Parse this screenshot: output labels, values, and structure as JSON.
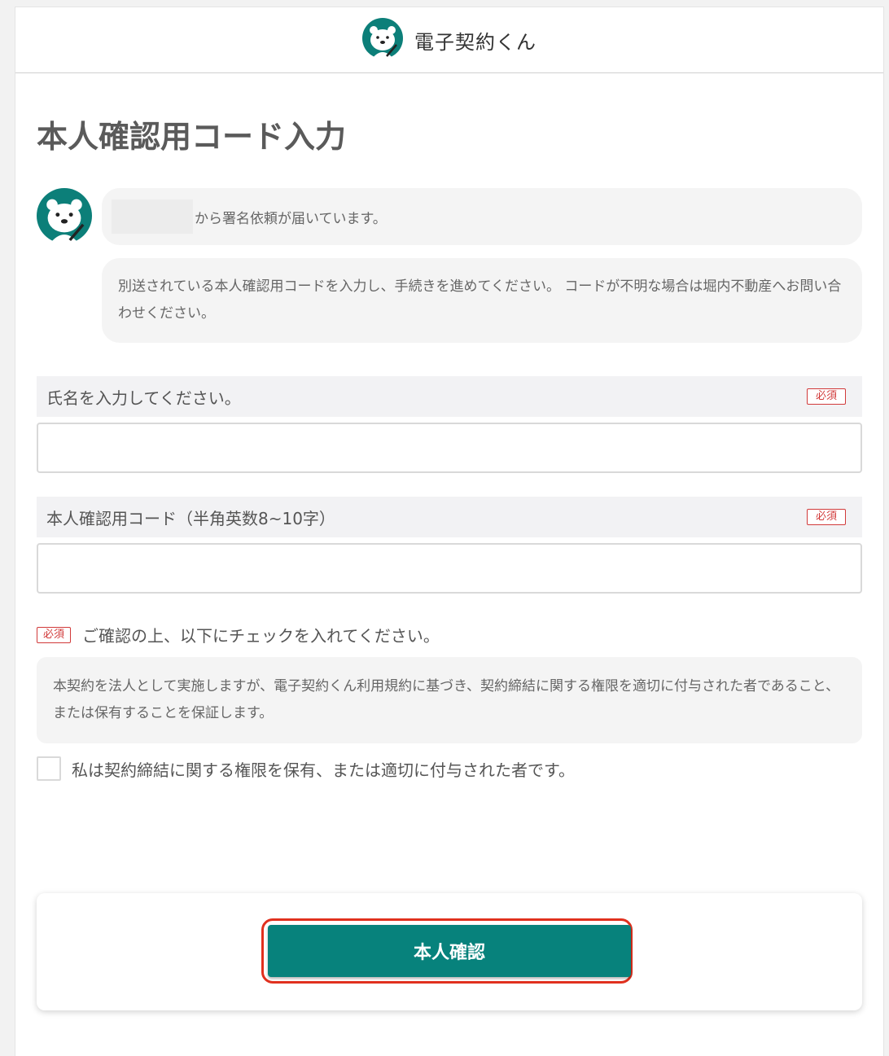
{
  "header": {
    "app_name": "電子契約くん",
    "logo_icon": "polar-bear-mascot-icon"
  },
  "page_title": "本人確認用コード入力",
  "messages": {
    "avatar_icon": "polar-bear-mascot-icon",
    "sender_suffix": "から署名依頼が届いています。",
    "instruction": "別送されている本人確認用コードを入力し、手続きを進めてください。 コードが不明な場合は堀内不動産へお問い合わせください。"
  },
  "name_field": {
    "label": "氏名を入力してください。",
    "required_badge": "必須",
    "value": "",
    "placeholder": ""
  },
  "code_field": {
    "label": "本人確認用コード（半角英数8~10字）",
    "required_badge": "必須",
    "value": "",
    "placeholder": ""
  },
  "confirm": {
    "required_badge": "必須",
    "label": "ご確認の上、以下にチェックを入れてください。",
    "terms_text": "本契約を法人として実施しますが、電子契約くん利用規約に基づき、契約締結に関する権限を適切に付与された者であること、または保有することを保証します。",
    "checkbox_label": "私は契約締結に関する権限を保有、または適切に付与された者です。",
    "checked": false
  },
  "submit": {
    "label": "本人確認"
  },
  "colors": {
    "accent": "#07827c",
    "required": "#d13a3a",
    "highlight": "#e0301e"
  }
}
